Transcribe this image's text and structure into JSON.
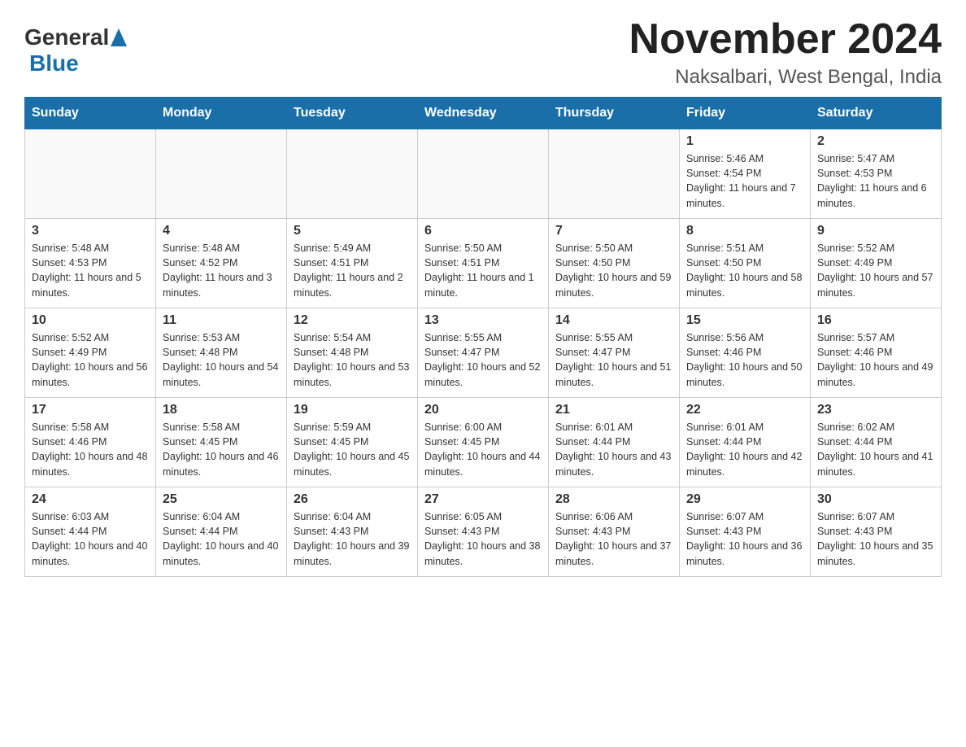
{
  "header": {
    "logo_general": "General",
    "logo_blue": "Blue",
    "month_year": "November 2024",
    "location": "Naksalbari, West Bengal, India"
  },
  "days_of_week": [
    "Sunday",
    "Monday",
    "Tuesday",
    "Wednesday",
    "Thursday",
    "Friday",
    "Saturday"
  ],
  "weeks": [
    [
      {
        "day": "",
        "info": ""
      },
      {
        "day": "",
        "info": ""
      },
      {
        "day": "",
        "info": ""
      },
      {
        "day": "",
        "info": ""
      },
      {
        "day": "",
        "info": ""
      },
      {
        "day": "1",
        "info": "Sunrise: 5:46 AM\nSunset: 4:54 PM\nDaylight: 11 hours and 7 minutes."
      },
      {
        "day": "2",
        "info": "Sunrise: 5:47 AM\nSunset: 4:53 PM\nDaylight: 11 hours and 6 minutes."
      }
    ],
    [
      {
        "day": "3",
        "info": "Sunrise: 5:48 AM\nSunset: 4:53 PM\nDaylight: 11 hours and 5 minutes."
      },
      {
        "day": "4",
        "info": "Sunrise: 5:48 AM\nSunset: 4:52 PM\nDaylight: 11 hours and 3 minutes."
      },
      {
        "day": "5",
        "info": "Sunrise: 5:49 AM\nSunset: 4:51 PM\nDaylight: 11 hours and 2 minutes."
      },
      {
        "day": "6",
        "info": "Sunrise: 5:50 AM\nSunset: 4:51 PM\nDaylight: 11 hours and 1 minute."
      },
      {
        "day": "7",
        "info": "Sunrise: 5:50 AM\nSunset: 4:50 PM\nDaylight: 10 hours and 59 minutes."
      },
      {
        "day": "8",
        "info": "Sunrise: 5:51 AM\nSunset: 4:50 PM\nDaylight: 10 hours and 58 minutes."
      },
      {
        "day": "9",
        "info": "Sunrise: 5:52 AM\nSunset: 4:49 PM\nDaylight: 10 hours and 57 minutes."
      }
    ],
    [
      {
        "day": "10",
        "info": "Sunrise: 5:52 AM\nSunset: 4:49 PM\nDaylight: 10 hours and 56 minutes."
      },
      {
        "day": "11",
        "info": "Sunrise: 5:53 AM\nSunset: 4:48 PM\nDaylight: 10 hours and 54 minutes."
      },
      {
        "day": "12",
        "info": "Sunrise: 5:54 AM\nSunset: 4:48 PM\nDaylight: 10 hours and 53 minutes."
      },
      {
        "day": "13",
        "info": "Sunrise: 5:55 AM\nSunset: 4:47 PM\nDaylight: 10 hours and 52 minutes."
      },
      {
        "day": "14",
        "info": "Sunrise: 5:55 AM\nSunset: 4:47 PM\nDaylight: 10 hours and 51 minutes."
      },
      {
        "day": "15",
        "info": "Sunrise: 5:56 AM\nSunset: 4:46 PM\nDaylight: 10 hours and 50 minutes."
      },
      {
        "day": "16",
        "info": "Sunrise: 5:57 AM\nSunset: 4:46 PM\nDaylight: 10 hours and 49 minutes."
      }
    ],
    [
      {
        "day": "17",
        "info": "Sunrise: 5:58 AM\nSunset: 4:46 PM\nDaylight: 10 hours and 48 minutes."
      },
      {
        "day": "18",
        "info": "Sunrise: 5:58 AM\nSunset: 4:45 PM\nDaylight: 10 hours and 46 minutes."
      },
      {
        "day": "19",
        "info": "Sunrise: 5:59 AM\nSunset: 4:45 PM\nDaylight: 10 hours and 45 minutes."
      },
      {
        "day": "20",
        "info": "Sunrise: 6:00 AM\nSunset: 4:45 PM\nDaylight: 10 hours and 44 minutes."
      },
      {
        "day": "21",
        "info": "Sunrise: 6:01 AM\nSunset: 4:44 PM\nDaylight: 10 hours and 43 minutes."
      },
      {
        "day": "22",
        "info": "Sunrise: 6:01 AM\nSunset: 4:44 PM\nDaylight: 10 hours and 42 minutes."
      },
      {
        "day": "23",
        "info": "Sunrise: 6:02 AM\nSunset: 4:44 PM\nDaylight: 10 hours and 41 minutes."
      }
    ],
    [
      {
        "day": "24",
        "info": "Sunrise: 6:03 AM\nSunset: 4:44 PM\nDaylight: 10 hours and 40 minutes."
      },
      {
        "day": "25",
        "info": "Sunrise: 6:04 AM\nSunset: 4:44 PM\nDaylight: 10 hours and 40 minutes."
      },
      {
        "day": "26",
        "info": "Sunrise: 6:04 AM\nSunset: 4:43 PM\nDaylight: 10 hours and 39 minutes."
      },
      {
        "day": "27",
        "info": "Sunrise: 6:05 AM\nSunset: 4:43 PM\nDaylight: 10 hours and 38 minutes."
      },
      {
        "day": "28",
        "info": "Sunrise: 6:06 AM\nSunset: 4:43 PM\nDaylight: 10 hours and 37 minutes."
      },
      {
        "day": "29",
        "info": "Sunrise: 6:07 AM\nSunset: 4:43 PM\nDaylight: 10 hours and 36 minutes."
      },
      {
        "day": "30",
        "info": "Sunrise: 6:07 AM\nSunset: 4:43 PM\nDaylight: 10 hours and 35 minutes."
      }
    ]
  ]
}
